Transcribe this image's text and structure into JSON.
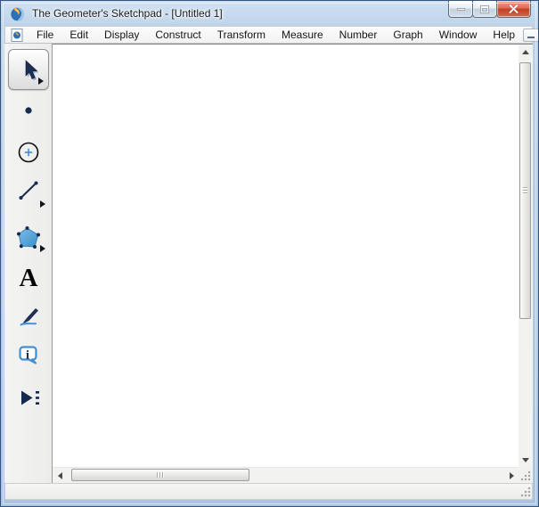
{
  "window": {
    "title": "The Geometer's Sketchpad - [Untitled 1]",
    "app_icon": "sketchpad-logo-icon",
    "controls": {
      "minimize": "minimize",
      "restore": "restore-down",
      "close": "close"
    }
  },
  "menubar": {
    "document_icon": "document-icon",
    "items": [
      "File",
      "Edit",
      "Display",
      "Construct",
      "Transform",
      "Measure",
      "Number",
      "Graph",
      "Window",
      "Help"
    ],
    "mdi_controls": {
      "minimize": "minimize-document",
      "restore": "restore-document",
      "close": "close-document"
    }
  },
  "toolbar": {
    "tools": [
      {
        "id": "selection-arrow-tool",
        "icon": "arrow-cursor-icon",
        "selected": true,
        "flyout": true
      },
      {
        "id": "point-tool",
        "icon": "point-icon",
        "selected": false,
        "flyout": false
      },
      {
        "id": "compass-tool",
        "icon": "circle-plus-icon",
        "selected": false,
        "flyout": false
      },
      {
        "id": "straightedge-tool",
        "icon": "segment-icon",
        "selected": false,
        "flyout": true
      },
      {
        "id": "polygon-tool",
        "icon": "pentagon-icon",
        "selected": false,
        "flyout": true
      },
      {
        "id": "text-tool",
        "icon": "letter-a-icon",
        "selected": false,
        "flyout": false,
        "glyph": "A"
      },
      {
        "id": "marker-tool",
        "icon": "marker-pen-icon",
        "selected": false,
        "flyout": false
      },
      {
        "id": "information-tool",
        "icon": "info-bubble-icon",
        "selected": false,
        "flyout": false
      },
      {
        "id": "custom-tools",
        "icon": "custom-tool-arrow-icon",
        "selected": false,
        "flyout": false
      }
    ]
  },
  "canvas": {
    "content": ""
  },
  "statusbar": {
    "text": ""
  },
  "colors": {
    "frame_blue": "#a9c4e2",
    "titlebar_top": "#cfe0f2",
    "close_red": "#c13f27",
    "menu_bg": "#f6f6f6",
    "toolbar_bg": "#f1f1ef",
    "tool_navy": "#1c2f55",
    "accent_blue": "#4a90d9",
    "pentagon_blue": "#4aa0dc",
    "canvas_white": "#ffffff"
  }
}
